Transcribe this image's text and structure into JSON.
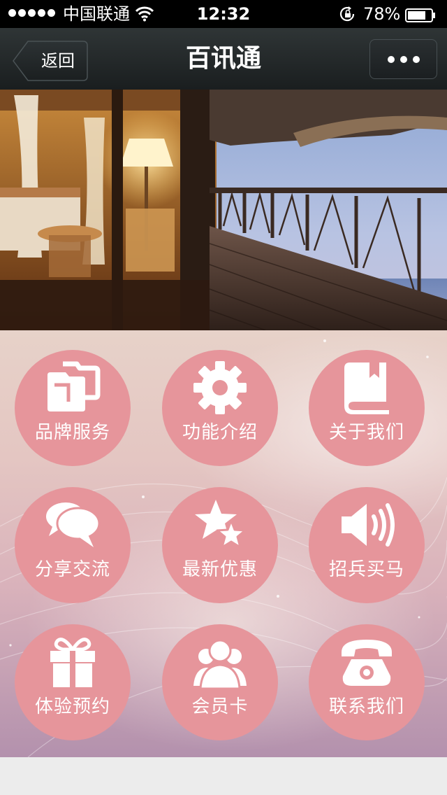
{
  "status_bar": {
    "carrier": "中国联通",
    "time": "12:32",
    "battery_percent": "78%",
    "battery_level": 0.78,
    "signal_icon": "signal-dots-icon",
    "wifi_icon": "wifi-icon",
    "rotation_lock_icon": "rotation-lock-icon"
  },
  "nav": {
    "back_label": "返回",
    "title": "百讯通",
    "more_icon": "ellipsis-icon"
  },
  "banner": {
    "image": "hotel-room-and-ocean-deck-photo"
  },
  "grid": {
    "tiles": [
      {
        "label": "品牌服务",
        "icon": "folders-icon"
      },
      {
        "label": "功能介绍",
        "icon": "gear-icon"
      },
      {
        "label": "关于我们",
        "icon": "book-icon"
      },
      {
        "label": "分享交流",
        "icon": "chat-bubbles-icon"
      },
      {
        "label": "最新优惠",
        "icon": "stars-icon"
      },
      {
        "label": "招兵买马",
        "icon": "speaker-icon"
      },
      {
        "label": "体验预约",
        "icon": "gift-icon"
      },
      {
        "label": "会员卡",
        "icon": "users-icon"
      },
      {
        "label": "联系我们",
        "icon": "telephone-icon"
      }
    ]
  },
  "colors": {
    "tile": "#e6959b",
    "nav_bar": "#23292a",
    "status_bar": "#000000",
    "footer": "#ececec"
  }
}
